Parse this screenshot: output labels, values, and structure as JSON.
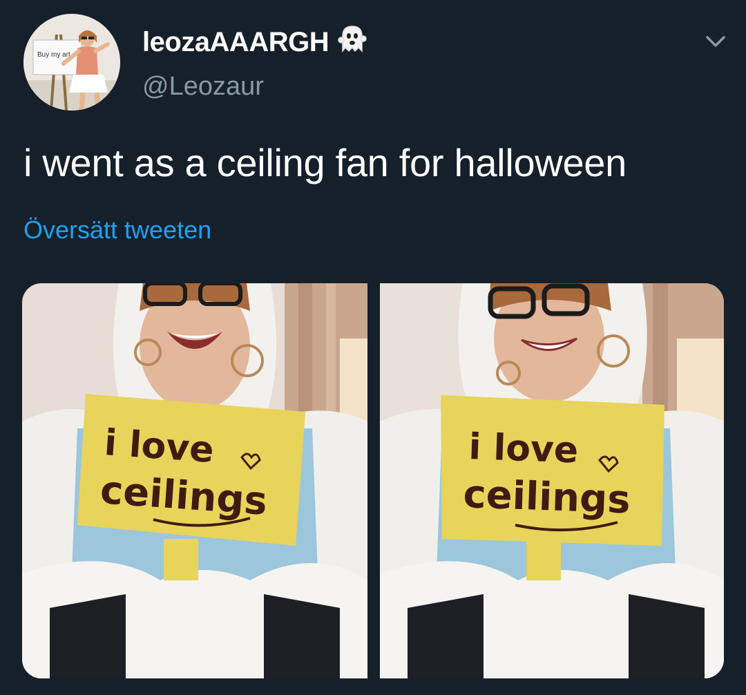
{
  "tweet": {
    "display_name": "leozaAAARGH",
    "handle": "@Leozaur",
    "text": "i went as a ceiling fan for halloween",
    "translate_link": "Översätt tweeten"
  },
  "avatar": {
    "sign_text": "Buy my art"
  },
  "photos": [
    {
      "sign_line1": "i love",
      "sign_line2": "ceilings"
    },
    {
      "sign_line1": "i love",
      "sign_line2": "ceilings"
    }
  ],
  "colors": {
    "background": "#15202b",
    "text": "#ffffff",
    "secondary": "#8899a6",
    "link": "#1da1f2",
    "sign": "#e8d45a",
    "ink": "#3e1c12"
  },
  "icons": {
    "name_emoji": "ghost-icon",
    "menu": "chevron-down-icon"
  }
}
